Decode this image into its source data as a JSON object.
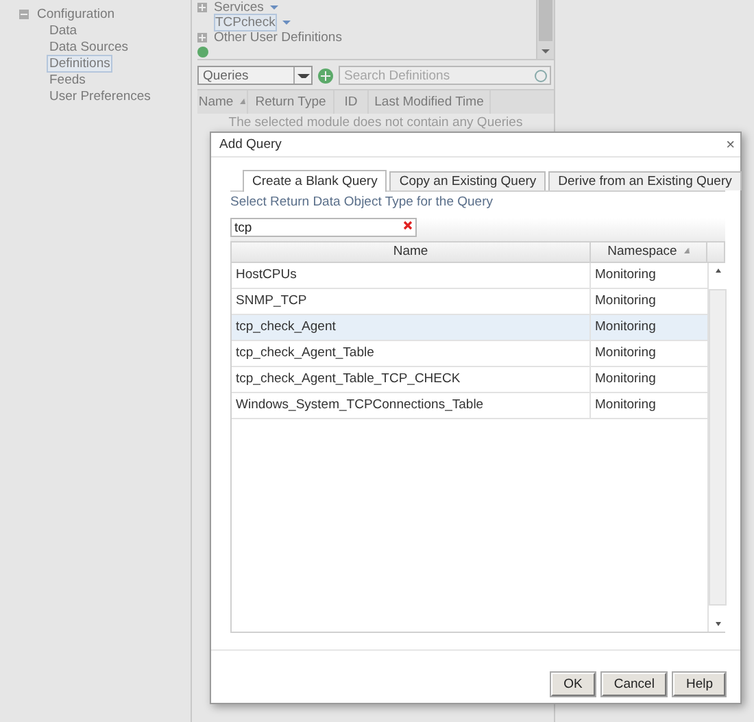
{
  "sidebar": {
    "items": [
      {
        "label": "Configuration",
        "expanded": true,
        "children": [
          {
            "label": "Data",
            "selected": false
          },
          {
            "label": "Data Sources",
            "selected": false
          },
          {
            "label": "Definitions",
            "selected": true
          },
          {
            "label": "Feeds",
            "selected": false
          },
          {
            "label": "User Preferences",
            "selected": false
          }
        ]
      }
    ]
  },
  "definitions": {
    "tree": [
      {
        "kind": "group",
        "label": "Services",
        "expanded": false,
        "menu": true,
        "selected": false
      },
      {
        "kind": "definition",
        "label": "TCPcheck",
        "menu": true,
        "selected": true
      },
      {
        "kind": "group",
        "label": "Other User Definitions",
        "expanded": false,
        "menu": false,
        "selected": false
      }
    ],
    "type_dropdown": {
      "value": "Queries"
    },
    "search": {
      "placeholder": "Search Definitions"
    },
    "table": {
      "columns": [
        {
          "label": "Name",
          "sorted": true
        },
        {
          "label": "Return Type",
          "sorted": false
        },
        {
          "label": "ID",
          "sorted": false
        },
        {
          "label": "Last Modified Time",
          "sorted": false
        }
      ],
      "empty_message": "The selected module does not contain any Queries"
    }
  },
  "dialog": {
    "title": "Add Query",
    "close": "×",
    "tabs": [
      {
        "label": "Create a Blank Query",
        "selected": true
      },
      {
        "label": "Copy an Existing Query",
        "selected": false
      },
      {
        "label": "Derive from an Existing Query",
        "selected": false
      }
    ],
    "instruction": "Select Return Data Object Type for the Query",
    "filter": {
      "value": "tcp"
    },
    "grid": {
      "columns": [
        {
          "label": "Name",
          "sorted": false
        },
        {
          "label": "Namespace",
          "sorted": true
        }
      ],
      "rows": [
        {
          "name": "HostCPUs",
          "namespace": "Monitoring",
          "selected": false
        },
        {
          "name": "SNMP_TCP",
          "namespace": "Monitoring",
          "selected": false
        },
        {
          "name": "tcp_check_Agent",
          "namespace": "Monitoring",
          "selected": true
        },
        {
          "name": "tcp_check_Agent_Table",
          "namespace": "Monitoring",
          "selected": false
        },
        {
          "name": "tcp_check_Agent_Table_TCP_CHECK",
          "namespace": "Monitoring",
          "selected": false
        },
        {
          "name": "Windows_System_TCPConnections_Table",
          "namespace": "Monitoring",
          "selected": false
        }
      ]
    },
    "buttons": [
      "OK",
      "Cancel",
      "Help"
    ]
  }
}
